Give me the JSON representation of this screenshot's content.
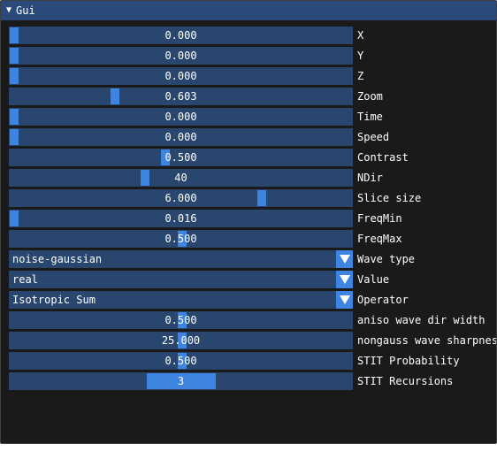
{
  "window": {
    "title": "Gui",
    "collapse_icon": "triangle-down-icon"
  },
  "controls": [
    {
      "kind": "slider",
      "label": "X",
      "value": "0.000",
      "fraction": 0.0
    },
    {
      "kind": "slider",
      "label": "Y",
      "value": "0.000",
      "fraction": 0.0
    },
    {
      "kind": "slider",
      "label": "Z",
      "value": "0.000",
      "fraction": 0.0
    },
    {
      "kind": "slider",
      "label": "Zoom",
      "value": "0.603",
      "fraction": 0.3
    },
    {
      "kind": "slider",
      "label": "Time",
      "value": "0.000",
      "fraction": 0.0
    },
    {
      "kind": "slider",
      "label": "Speed",
      "value": "0.000",
      "fraction": 0.0
    },
    {
      "kind": "slider",
      "label": "Contrast",
      "value": "0.500",
      "fraction": 0.45
    },
    {
      "kind": "slider",
      "label": "NDir",
      "value": "40",
      "fraction": 0.39
    },
    {
      "kind": "slider",
      "label": "Slice size",
      "value": "6.000",
      "fraction": 0.74
    },
    {
      "kind": "slider",
      "label": "FreqMin",
      "value": "0.016",
      "fraction": 0.0
    },
    {
      "kind": "slider",
      "label": "FreqMax",
      "value": "0.500",
      "fraction": 0.5
    },
    {
      "kind": "combo",
      "label": "Wave type",
      "value": "noise-gaussian",
      "arrow_icon": "triangle-down-icon"
    },
    {
      "kind": "combo",
      "label": "Value",
      "value": "real",
      "arrow_icon": "triangle-down-icon"
    },
    {
      "kind": "combo",
      "label": "Operator",
      "value": "Isotropic Sum",
      "arrow_icon": "triangle-down-icon"
    },
    {
      "kind": "slider",
      "label": "aniso wave dir width",
      "value": "0.500",
      "fraction": 0.5
    },
    {
      "kind": "slider",
      "label": "nongauss wave sharpness",
      "value": "25.000",
      "fraction": 0.5
    },
    {
      "kind": "slider",
      "label": "STIT Probability",
      "value": "0.500",
      "fraction": 0.5
    },
    {
      "kind": "slider-wide",
      "label": "STIT Recursions",
      "value": "3",
      "fraction": 0.4
    }
  ],
  "colors": {
    "window_bg": "#1a1a1a",
    "title_bg": "#294a7a",
    "frame_bg": "#29466f",
    "accent": "#3d85e0",
    "text": "#ffffff"
  }
}
